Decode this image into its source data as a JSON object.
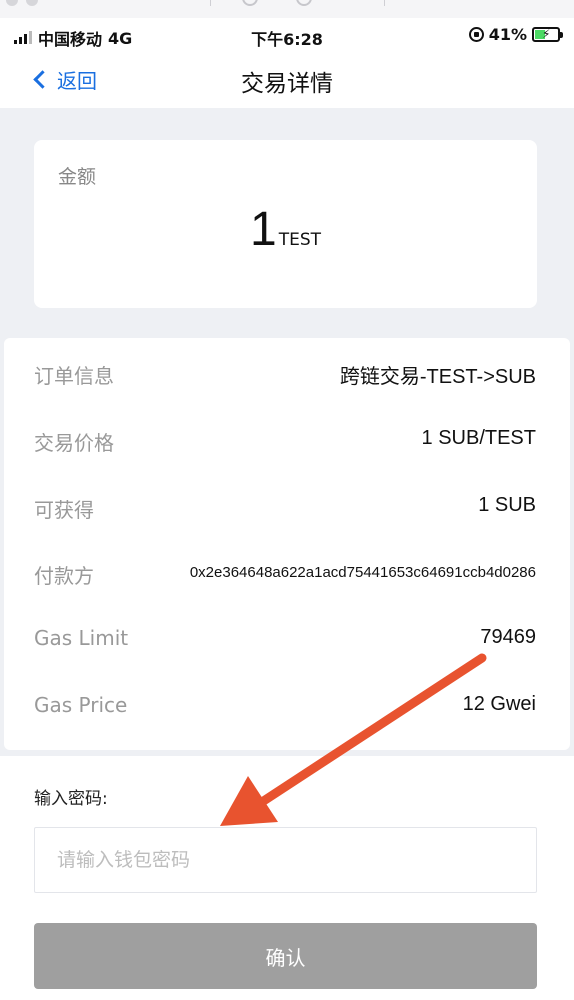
{
  "status_bar": {
    "carrier": "中国移动",
    "network": "4G",
    "time": "下午6:28",
    "battery": "41%"
  },
  "header": {
    "back_label": "返回",
    "title": "交易详情"
  },
  "amount": {
    "label": "金额",
    "value": "1",
    "unit": "TEST"
  },
  "details": [
    {
      "key": "订单信息",
      "value": "跨链交易-TEST->SUB"
    },
    {
      "key": "交易价格",
      "value": "1 SUB/TEST"
    },
    {
      "key": "可获得",
      "value": "1 SUB"
    },
    {
      "key": "付款方",
      "value": "0x2e364648a622a1acd75441653c64691ccb4d0286"
    },
    {
      "key": "Gas Limit",
      "value": "79469"
    },
    {
      "key": "Gas Price",
      "value": "12 Gwei"
    }
  ],
  "password": {
    "label": "输入密码:",
    "placeholder": "请输入钱包密码",
    "value": ""
  },
  "confirm_label": "确认",
  "colors": {
    "accent": "#1a6fe0",
    "annotation_arrow": "#e8532f",
    "confirm_disabled": "#9f9f9f",
    "page_band": "#eef0f4"
  },
  "icons": [
    "signal-icon",
    "rotation-lock-icon",
    "battery-icon",
    "chevron-left-icon",
    "arrow-annotation"
  ]
}
